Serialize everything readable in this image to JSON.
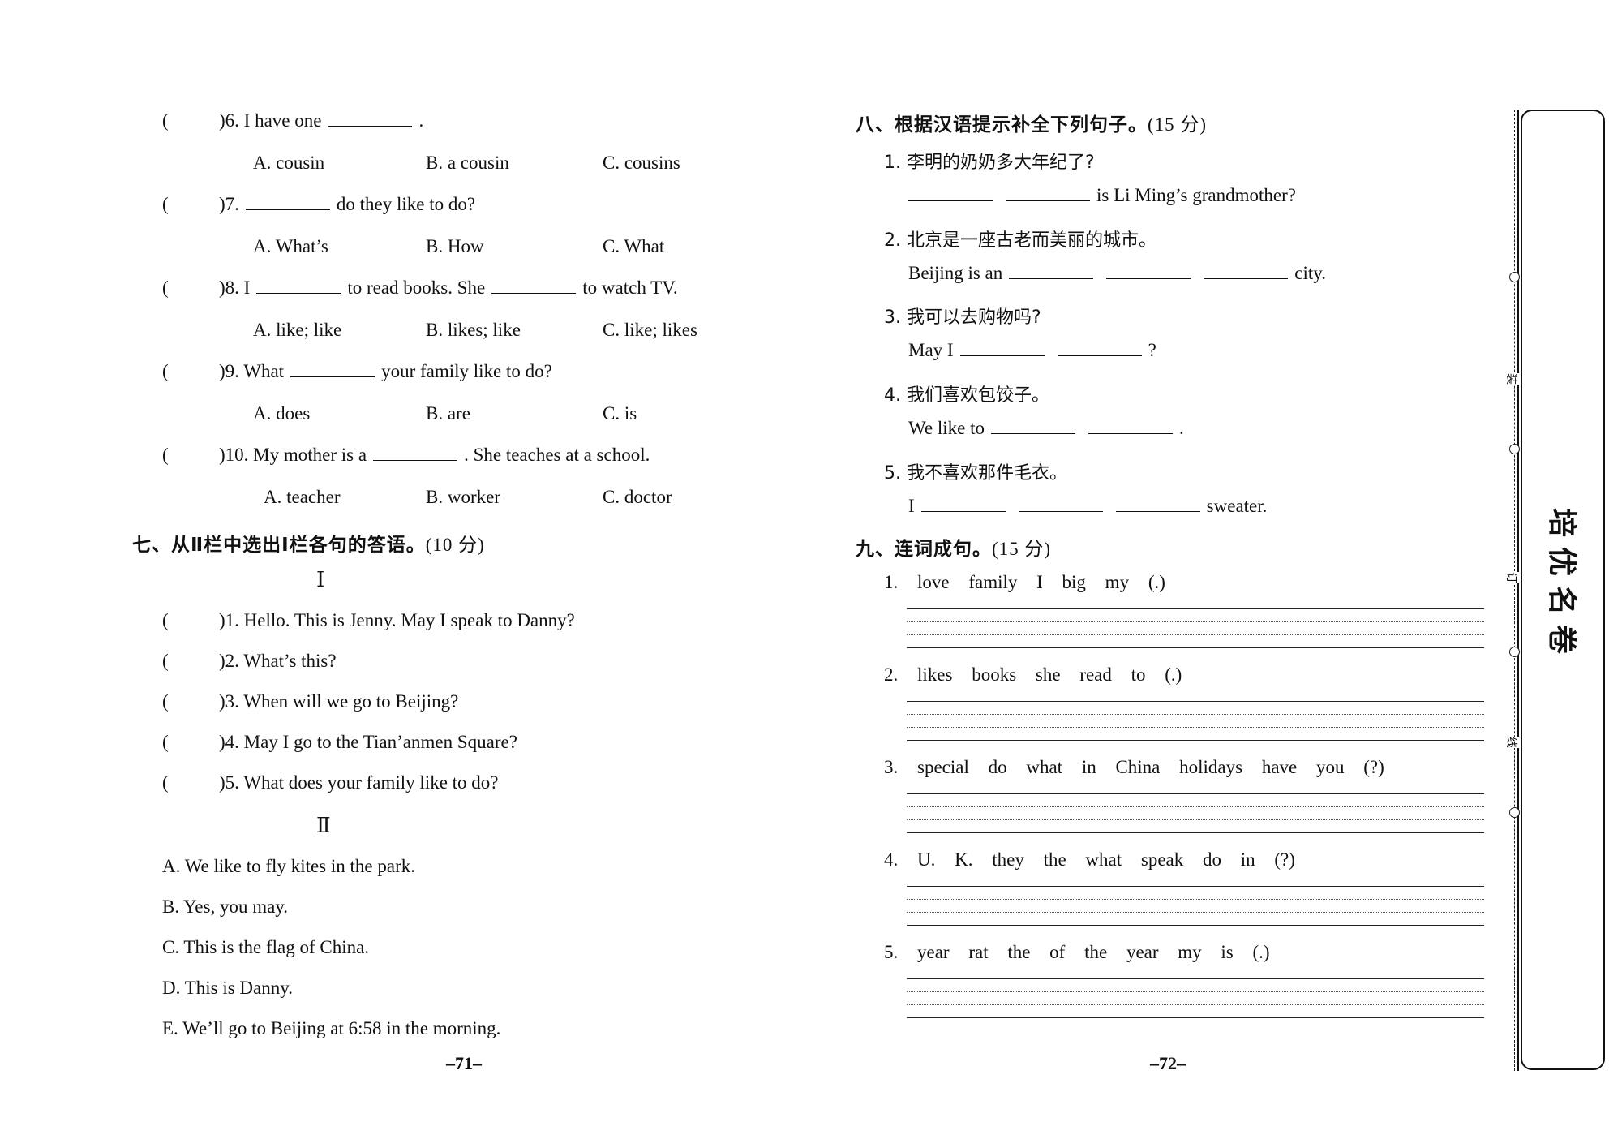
{
  "left_page": {
    "mc_items": [
      {
        "paren": "(",
        "num": ")6.",
        "pre": "I have one",
        "post": ".",
        "blanks": 1,
        "options": [
          "A. cousin",
          "B. a cousin",
          "C. cousins"
        ]
      },
      {
        "paren": "(",
        "num": ")7.",
        "pre": "",
        "post": "do they like to do?",
        "blanks": 1,
        "options": [
          "A. What’s",
          "B. How",
          "C. What"
        ]
      },
      {
        "paren": "(",
        "num": ")8.",
        "pre": "I",
        "mid": "to read books. She",
        "post": "to watch TV.",
        "blanks": 2,
        "options": [
          "A. like; like",
          "B. likes; like",
          "C. like; likes"
        ]
      },
      {
        "paren": "(",
        "num": ")9.",
        "pre": "What",
        "post": "your family like to do?",
        "blanks": 1,
        "options": [
          "A. does",
          "B. are",
          "C. is"
        ]
      },
      {
        "paren": "(",
        "num": ")10.",
        "pre": "My mother is a",
        "post": ". She teaches at a school.",
        "blanks": 1,
        "options": [
          "A. teacher",
          "B. worker",
          "C. doctor"
        ]
      }
    ],
    "section7": {
      "heading": "七、从Ⅱ栏中选出Ⅰ栏各句的答语。",
      "points": "(10 分)",
      "column1_label": "Ⅰ",
      "column1_items": [
        {
          "paren": "(",
          "text": ")1. Hello. This is Jenny. May I speak to Danny?"
        },
        {
          "paren": "(",
          "text": ")2. What’s this?"
        },
        {
          "paren": "(",
          "text": ")3. When will we go to Beijing?"
        },
        {
          "paren": "(",
          "text": ")4. May I go to the Tian’anmen Square?"
        },
        {
          "paren": "(",
          "text": ")5. What does your family like to do?"
        }
      ],
      "column2_label": "Ⅱ",
      "column2_items": [
        "A. We like to fly kites in the park.",
        "B. Yes, you may.",
        "C. This is the flag of China.",
        "D. This is Danny.",
        "E. We’ll go to Beijing at 6:58 in the morning."
      ]
    },
    "page_number": "–71–"
  },
  "right_page": {
    "section8": {
      "heading": "八、根据汉语提示补全下列句子。",
      "points": "(15 分)",
      "items": [
        {
          "cn": "1. 李明的奶奶多大年纪了?",
          "en_pre": "",
          "en_post": "is Li Ming’s grandmother?",
          "blanks": 2
        },
        {
          "cn": "2. 北京是一座古老而美丽的城市。",
          "en_pre": "Beijing is an",
          "en_post": "city.",
          "blanks": 3
        },
        {
          "cn": "3. 我可以去购物吗?",
          "en_pre": "May I",
          "en_post": "?",
          "blanks": 2
        },
        {
          "cn": "4. 我们喜欢包饺子。",
          "en_pre": "We like to",
          "en_post": ".",
          "blanks": 2
        },
        {
          "cn": "5. 我不喜欢那件毛衣。",
          "en_pre": "I",
          "en_post": "sweater.",
          "blanks": 3
        }
      ]
    },
    "section9": {
      "heading": "九、连词成句。",
      "points": "(15 分)",
      "items": [
        "1. love   family   I   big   my   (.)",
        "2. likes   books   she   read   to   (.)",
        "3. special   do   what   in   China   holidays   have   you   (?)",
        "4. U. K.   they   the   what   speak   do   in   (?)",
        "5. year   rat   the   of   the   year   my   is   (.)"
      ]
    },
    "page_number": "–72–"
  },
  "margin": {
    "binding_marks": [
      "装",
      "订",
      "线"
    ],
    "logo_chars": [
      "培",
      "优",
      "名",
      "卷"
    ]
  }
}
